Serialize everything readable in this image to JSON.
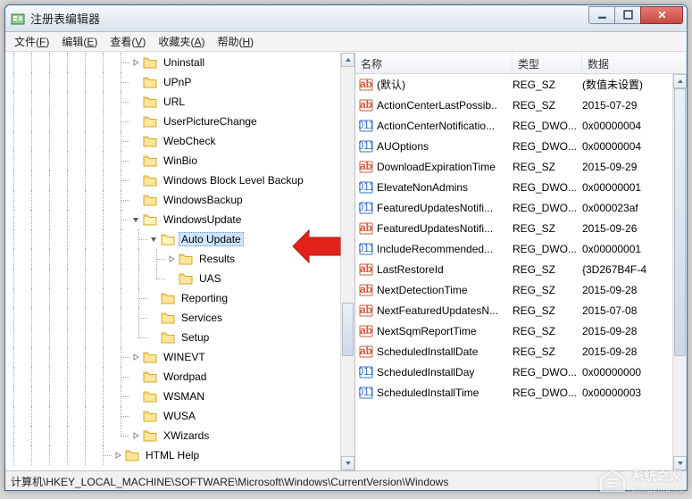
{
  "window": {
    "title": "注册表编辑器"
  },
  "menu": {
    "file": {
      "label": "文件",
      "accel": "F"
    },
    "edit": {
      "label": "编辑",
      "accel": "E"
    },
    "view": {
      "label": "查看",
      "accel": "V"
    },
    "fav": {
      "label": "收藏夹",
      "accel": "A"
    },
    "help": {
      "label": "帮助",
      "accel": "H"
    }
  },
  "tree": [
    {
      "indent": 7,
      "exp": "closed",
      "label": "Uninstall"
    },
    {
      "indent": 7,
      "exp": "none",
      "label": "UPnP"
    },
    {
      "indent": 7,
      "exp": "none",
      "label": "URL"
    },
    {
      "indent": 7,
      "exp": "none",
      "label": "UserPictureChange"
    },
    {
      "indent": 7,
      "exp": "none",
      "label": "WebCheck"
    },
    {
      "indent": 7,
      "exp": "none",
      "label": "WinBio"
    },
    {
      "indent": 7,
      "exp": "none",
      "label": "Windows Block Level Backup"
    },
    {
      "indent": 7,
      "exp": "none",
      "label": "WindowsBackup"
    },
    {
      "indent": 7,
      "exp": "open",
      "label": "WindowsUpdate"
    },
    {
      "indent": 8,
      "exp": "open",
      "label": "Auto Update",
      "selected": true
    },
    {
      "indent": 9,
      "exp": "closed",
      "label": "Results"
    },
    {
      "indent": 9,
      "exp": "none",
      "label": "UAS",
      "lastChild": true
    },
    {
      "indent": 8,
      "exp": "none",
      "label": "Reporting"
    },
    {
      "indent": 8,
      "exp": "none",
      "label": "Services"
    },
    {
      "indent": 8,
      "exp": "none",
      "label": "Setup",
      "lastChild": true
    },
    {
      "indent": 7,
      "exp": "closed",
      "label": "WINEVT"
    },
    {
      "indent": 7,
      "exp": "none",
      "label": "Wordpad"
    },
    {
      "indent": 7,
      "exp": "none",
      "label": "WSMAN"
    },
    {
      "indent": 7,
      "exp": "none",
      "label": "WUSA"
    },
    {
      "indent": 7,
      "exp": "closed",
      "label": "XWizards",
      "lastChild": true
    },
    {
      "indent": 6,
      "exp": "closed",
      "label": "HTML Help"
    }
  ],
  "list": {
    "headers": {
      "name": "名称",
      "type": "类型",
      "data": "数据"
    },
    "rows": [
      {
        "icon": "sz",
        "name": "(默认)",
        "type": "REG_SZ",
        "data": "(数值未设置)"
      },
      {
        "icon": "sz",
        "name": "ActionCenterLastPossib..",
        "type": "REG_SZ",
        "data": "2015-07-29"
      },
      {
        "icon": "dw",
        "name": "ActionCenterNotificatio...",
        "type": "REG_DWO...",
        "data": "0x00000004"
      },
      {
        "icon": "dw",
        "name": "AUOptions",
        "type": "REG_DWO...",
        "data": "0x00000004"
      },
      {
        "icon": "sz",
        "name": "DownloadExpirationTime",
        "type": "REG_SZ",
        "data": "2015-09-29"
      },
      {
        "icon": "dw",
        "name": "ElevateNonAdmins",
        "type": "REG_DWO...",
        "data": "0x00000001"
      },
      {
        "icon": "dw",
        "name": "FeaturedUpdatesNotifi...",
        "type": "REG_DWO...",
        "data": "0x000023af"
      },
      {
        "icon": "sz",
        "name": "FeaturedUpdatesNotifi...",
        "type": "REG_SZ",
        "data": "2015-09-26"
      },
      {
        "icon": "dw",
        "name": "IncludeRecommended...",
        "type": "REG_DWO...",
        "data": "0x00000001"
      },
      {
        "icon": "sz",
        "name": "LastRestoreId",
        "type": "REG_SZ",
        "data": "{3D267B4F-4"
      },
      {
        "icon": "sz",
        "name": "NextDetectionTime",
        "type": "REG_SZ",
        "data": "2015-09-28"
      },
      {
        "icon": "sz",
        "name": "NextFeaturedUpdatesN...",
        "type": "REG_SZ",
        "data": "2015-07-08"
      },
      {
        "icon": "sz",
        "name": "NextSqmReportTime",
        "type": "REG_SZ",
        "data": "2015-09-28"
      },
      {
        "icon": "sz",
        "name": "ScheduledInstallDate",
        "type": "REG_SZ",
        "data": "2015-09-28"
      },
      {
        "icon": "dw",
        "name": "ScheduledInstallDay",
        "type": "REG_DWO...",
        "data": "0x00000000"
      },
      {
        "icon": "dw",
        "name": "ScheduledInstallTime",
        "type": "REG_DWO...",
        "data": "0x00000003"
      }
    ]
  },
  "status": {
    "path": "计算机\\HKEY_LOCAL_MACHINE\\SOFTWARE\\Microsoft\\Windows\\CurrentVersion\\Windows"
  },
  "watermark": {
    "text": "系统之家",
    "url": "xongzhia.ne"
  }
}
